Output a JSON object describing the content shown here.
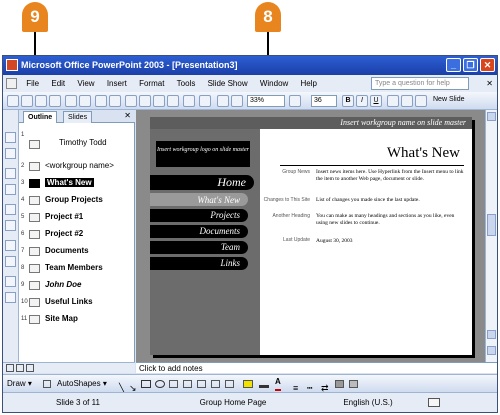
{
  "callouts": [
    {
      "number": "9",
      "color": "#e8851e"
    },
    {
      "number": "8",
      "color": "#e8851e"
    }
  ],
  "window": {
    "title": "Microsoft Office PowerPoint 2003 - [Presentation3]",
    "controls": {
      "minimize": "_",
      "restore": "❐",
      "close": "✕"
    }
  },
  "menu": {
    "items": [
      "File",
      "Edit",
      "View",
      "Insert",
      "Format",
      "Tools",
      "Slide Show",
      "Window",
      "Help"
    ],
    "help_placeholder": "Type a question for help",
    "doc_close": "✕"
  },
  "toolbar": {
    "zoom": "33%",
    "font_size": "36",
    "bold": "B",
    "italic": "I",
    "underline": "U",
    "new_slide": "New Slide"
  },
  "outline_panel": {
    "tabs": [
      "Outline",
      "Slides"
    ],
    "close": "✕",
    "slides": [
      {
        "num": "1",
        "lines": [
          "Timothy Todd"
        ]
      },
      {
        "num": "2",
        "lines": [
          "<workgroup name>"
        ]
      },
      {
        "num": "3",
        "lines": [
          "What's New"
        ],
        "selected": true
      },
      {
        "num": "4",
        "lines": [
          "Group Projects"
        ]
      },
      {
        "num": "5",
        "lines": [
          "Project #1"
        ]
      },
      {
        "num": "6",
        "lines": [
          "Project #2"
        ]
      },
      {
        "num": "7",
        "lines": [
          "Documents"
        ]
      },
      {
        "num": "8",
        "lines": [
          "Team Members"
        ]
      },
      {
        "num": "9",
        "lines": [
          "John Doe"
        ],
        "italic": true
      },
      {
        "num": "10",
        "lines": [
          "Useful Links"
        ]
      },
      {
        "num": "11",
        "lines": [
          "Site Map"
        ]
      }
    ]
  },
  "slide": {
    "top_banner": "Insert workgroup name on slide master",
    "logo_text": "Insert workgroup logo on slide master",
    "nav": [
      "Home",
      "What's New",
      "Projects",
      "Documents",
      "Team",
      "Links"
    ],
    "title": "What's New",
    "labels": [
      "Group News",
      "Changes to This Site",
      "Another Heading",
      "Last Update"
    ],
    "body": [
      "Insert news items here. Use Hyperlink from the Insert menu to link the item to another Web page, document or slide.",
      "List of changes you made since the last update.",
      "You can make as many headings and sections as you like, even using new slides to continue.",
      "August 30, 2003"
    ]
  },
  "notes": {
    "placeholder": "Click to add notes"
  },
  "drawing": {
    "draw_label": "Draw ▾",
    "autoshapes_label": "AutoShapes ▾"
  },
  "status": {
    "slide": "Slide 3 of 11",
    "design": "Group Home Page",
    "language": "English (U.S.)"
  }
}
